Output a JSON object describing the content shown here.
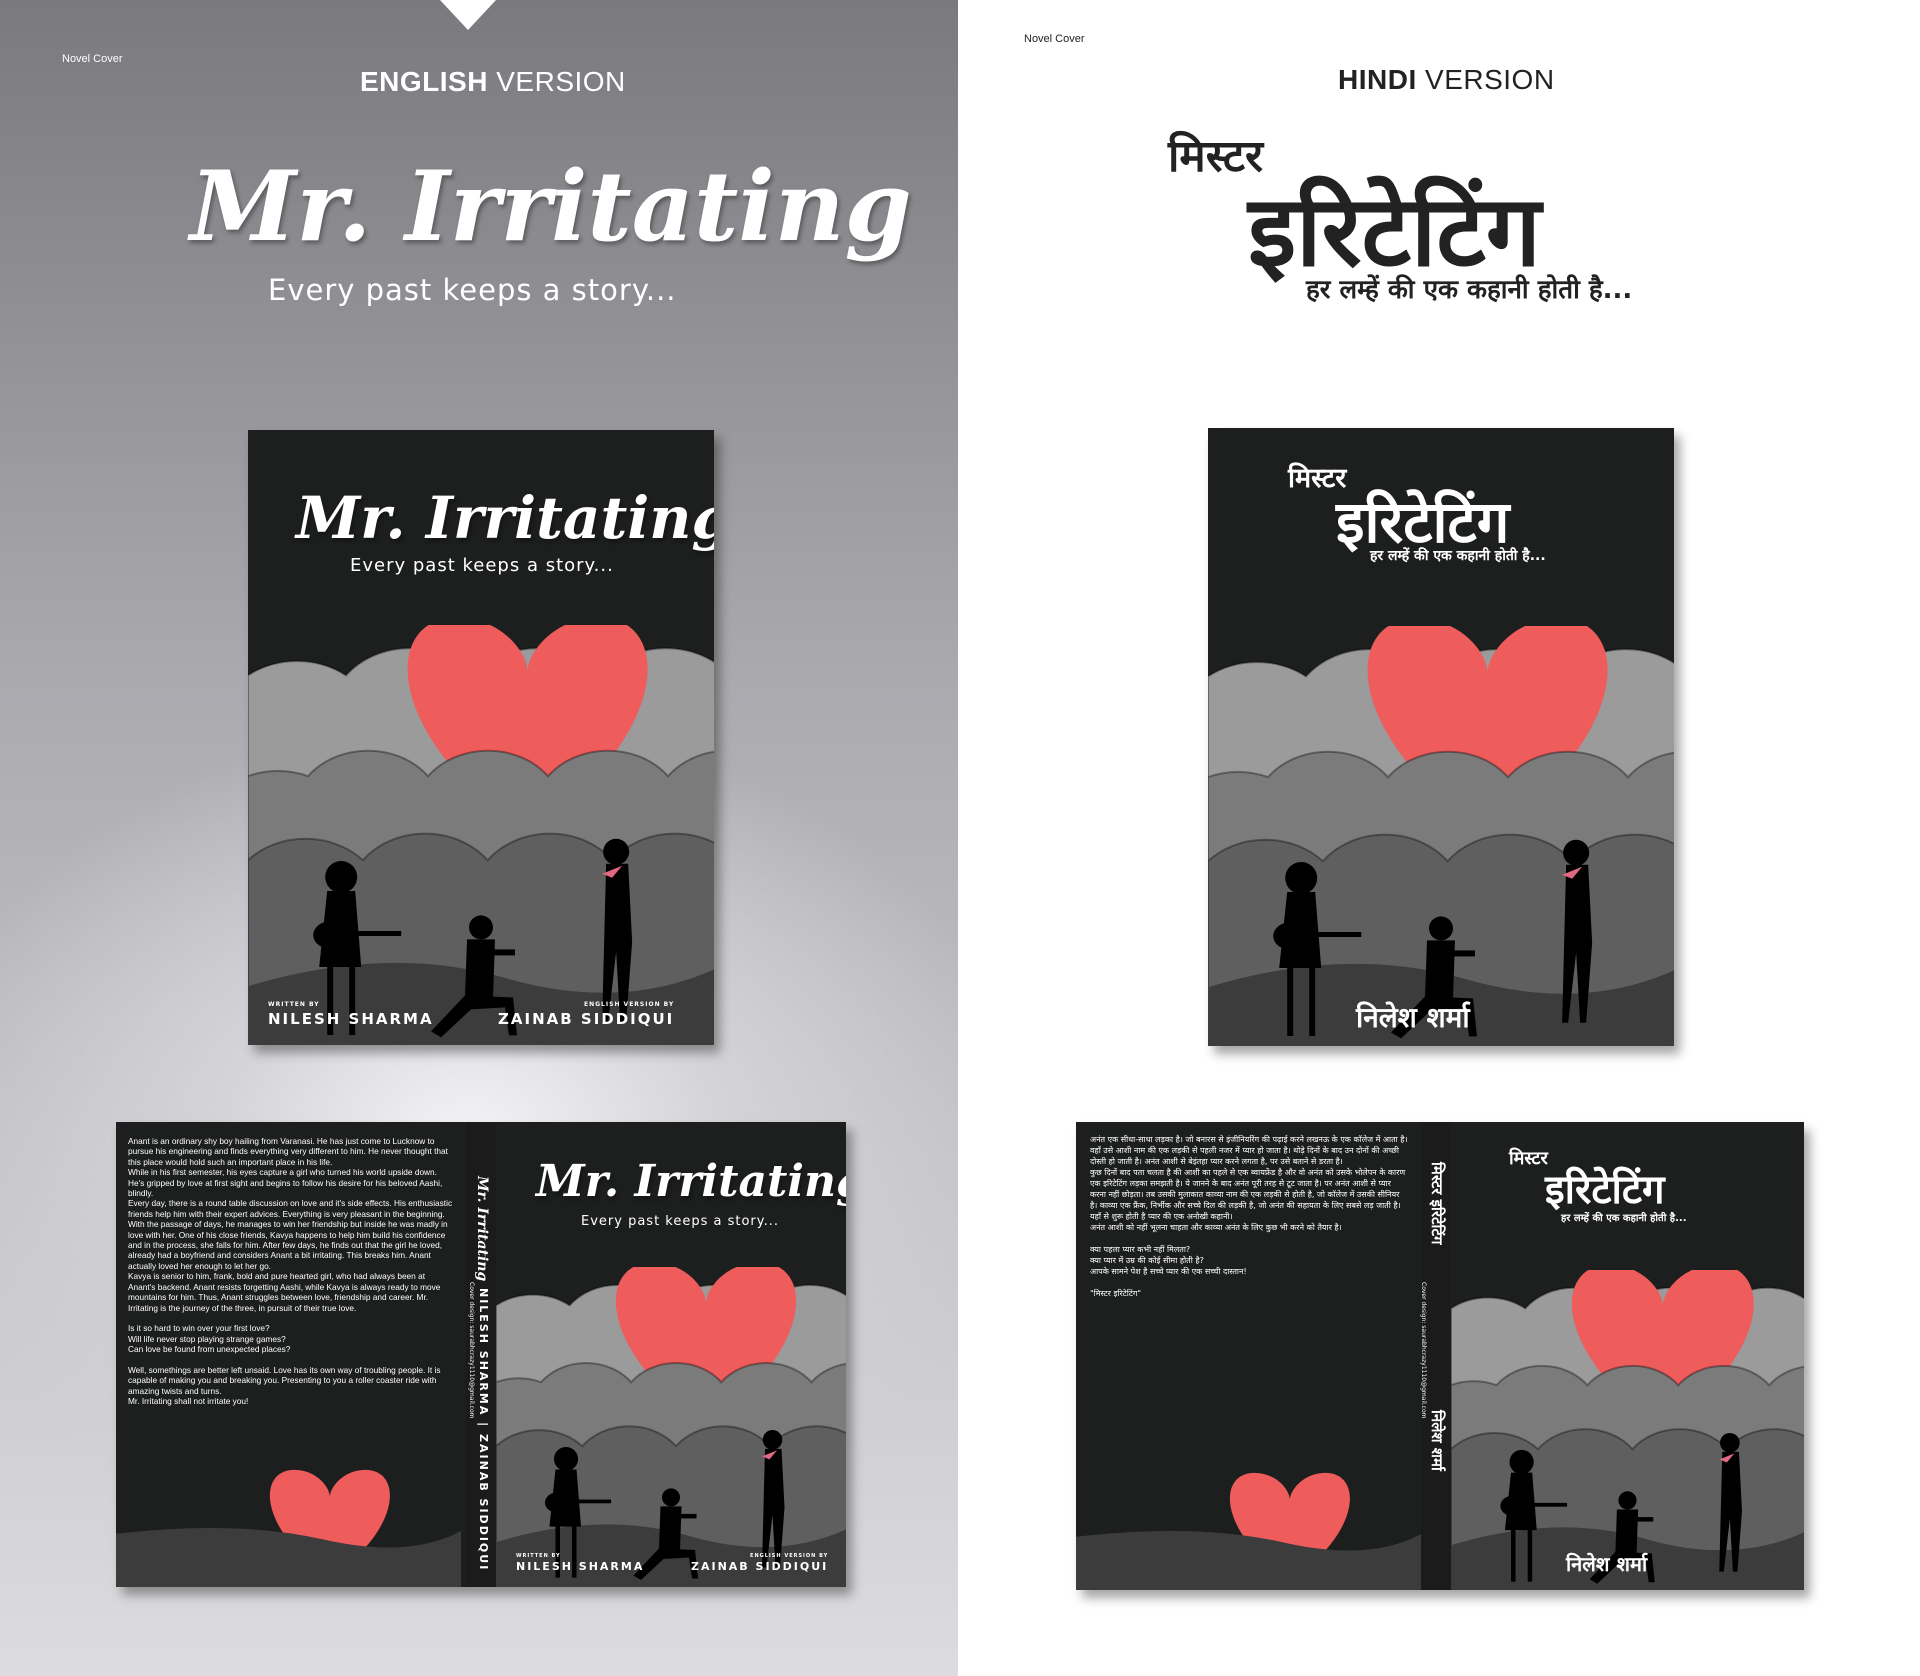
{
  "left": {
    "tag": "Novel Cover",
    "version_bold": "ENGLISH",
    "version_rest": " VERSION",
    "title": "Mr. Irritating",
    "tagline": "Every past keeps a story...",
    "front": {
      "title": "Mr. Irritating",
      "tagline": "Every past keeps a story...",
      "written_by": "WRITTEN BY",
      "author": "NILESH SHARMA",
      "english_by": "ENGLISH VERSION BY",
      "translator": "ZAINAB SIDDIQUI"
    },
    "spread": {
      "blurb": [
        "Anant is an ordinary shy boy hailing from Varanasi. He has just come to Lucknow to pursue his engineering and finds everything very different to him. He never thought that this place would hold such an important place in his life.",
        "While in his first semester, his eyes capture a girl who turned his world upside down. He's gripped by love at first sight and begins to follow his desire for his beloved Aashi, blindly.",
        "Every day, there is a round table discussion on love and it's side effects. His enthusiastic friends help him with their expert advices. Everything is very pleasant in the beginning.",
        "With the passage of days, he manages to win her friendship but inside he was madly in love with her. One of his close friends, Kavya happens to help him build his confidence and in the process, she falls for him. After few days, he finds out that the girl he loved, already had a boyfriend and considers Anant a bit irritating. This breaks him. Anant actually loved her enough to let her go.",
        "Kavya is senior to him, frank, bold and pure hearted girl, who had always been at Anant's backend. Anant resists forgetting Aashi, while Kavya is always ready to move mountains for him. Thus, Anant struggles between love, friendship and career. Mr. Irritating is the journey of the three, in pursuit of their true love.",
        "",
        "Is it so hard to win over your first love?",
        "Will life never stop playing strange games?",
        "Can love be found from unexpected places?",
        "",
        "Well, somethings are better left unsaid. Love has its own way of troubling people. It is capable of making you and breaking you. Presenting to you a roller coaster ride with amazing twists and turns.",
        "Mr. Irritating shall not irritate you!"
      ],
      "spine_title": "Mr. Irritating",
      "spine_authors": "NILESH SHARMA | ZAINAB SIDDIQUI",
      "spine_credit": "Cover design: saurabhcrazy1110@gmail.com",
      "title": "Mr. Irritating",
      "tagline": "Every past keeps a story...",
      "written_by": "WRITTEN BY",
      "author": "NILESH SHARMA",
      "english_by": "ENGLISH VERSION BY",
      "translator": "ZAINAB SIDDIQUI"
    }
  },
  "right": {
    "tag": "Novel Cover",
    "version_bold": "HINDI",
    "version_rest": " VERSION",
    "title_small": "मिस्टर",
    "title_big": "इरिटेटिंग",
    "tagline": "हर लम्हें की एक कहानी होती है...",
    "front": {
      "title_small": "मिस्टर",
      "title_big": "इरिटेटिंग",
      "tagline": "हर लम्हें की एक कहानी होती है...",
      "author": "निलेश शर्मा"
    },
    "spread": {
      "blurb": [
        "अनंत एक सीधा-साधा लड़का है। जो बनारस से इंजीनियरिंग की पढ़ाई करने लखनऊ के एक कॉलेज में आता है। वहाँ उसे आशी नाम की एक लड़की से पहली नजर में प्यार हो जाता है। थोड़े दिनों के बाद उन दोनों की अच्छी दोस्ती हो जाती है। अनंत आशी से बेइंतहा प्यार करने लगता है, पर उसे बताने से डरता है।",
        "कुछ दिनों बाद पता चलता है की आशी का पहले से एक ब्वायफ्रेंड है और वो अनंत को उसके भोलेपन के कारण एक इरिटेटिंग लड़का समझती है। ये जानने के बाद अनंत पूरी तरह से टूट जाता है। पर अनंत आशी से प्यार करना नहीं छोड़ता। तब उसकी मुलाकात काव्या नाम की एक लड़की से होती है, जो कॉलेज में उसकी सीनियर है। काव्या एक फ्रैंक, निर्भीक और सच्चे दिल की लड़की है, जो अनंत की सहायता के लिए सबसे लड़ जाती है।",
        "यहाँ से शुरू होती है प्यार की एक अनोखी कहानी।",
        "अनंत आशी को नहीं भूलना चाहता और काव्या अनंत के लिए कुछ भी करने को तैयार है।",
        "",
        "क्या पहला प्यार कभी नहीं मिलता?",
        "क्या प्यार में उम्र की कोई सीमा होती है?",
        "आपके सामने पेश है सच्चे प्यार की एक सच्ची दास्तान!",
        "",
        "\"मिस्टर इरिटेटिंग\""
      ],
      "spine_title": "मिस्टर इरिटेटिंग",
      "spine_author": "निलेश शर्मा",
      "spine_credit": "Cover design: saurabhcrazy1110@gmail.com",
      "title_small": "मिस्टर",
      "title_big": "इरिटेटिंग",
      "tagline": "हर लम्हें की एक कहानी होती है...",
      "author": "निलेश शर्मा"
    }
  },
  "colors": {
    "cover_bg": "#1d1f1e",
    "heart": "#ee5c5c",
    "cloud_light": "#9b9b9b",
    "cloud_mid": "#7b7b7b",
    "cloud_dark": "#5f5f60",
    "ground": "#3c3c3d",
    "scarf": "#e06880"
  },
  "icons": [
    "heart-icon",
    "guitar-girl-silhouette",
    "kneeling-man-silhouette",
    "standing-woman-silhouette"
  ]
}
